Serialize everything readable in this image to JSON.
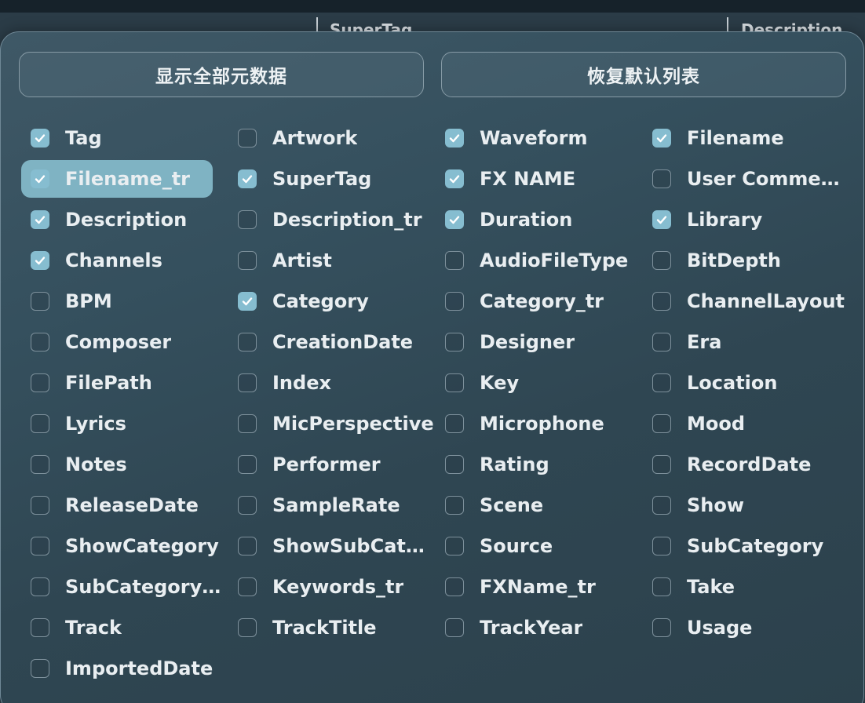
{
  "background": {
    "columns": [
      "SuperTag",
      "Description"
    ]
  },
  "buttons": {
    "show_all": "显示全部元数据",
    "restore_default": "恢复默认列表"
  },
  "items": [
    {
      "label": "Tag",
      "checked": true
    },
    {
      "label": "Artwork",
      "checked": false
    },
    {
      "label": "Waveform",
      "checked": true
    },
    {
      "label": "Filename",
      "checked": true
    },
    {
      "label": "Filename_tr",
      "checked": true,
      "highlighted": true
    },
    {
      "label": "SuperTag",
      "checked": true
    },
    {
      "label": "FX NAME",
      "checked": true
    },
    {
      "label": "User Comments",
      "checked": false
    },
    {
      "label": "Description",
      "checked": true
    },
    {
      "label": "Description_tr",
      "checked": false
    },
    {
      "label": "Duration",
      "checked": true
    },
    {
      "label": "Library",
      "checked": true
    },
    {
      "label": "Channels",
      "checked": true
    },
    {
      "label": "Artist",
      "checked": false
    },
    {
      "label": "AudioFileType",
      "checked": false
    },
    {
      "label": "BitDepth",
      "checked": false
    },
    {
      "label": "BPM",
      "checked": false
    },
    {
      "label": "Category",
      "checked": true
    },
    {
      "label": "Category_tr",
      "checked": false
    },
    {
      "label": "ChannelLayout",
      "checked": false
    },
    {
      "label": "Composer",
      "checked": false
    },
    {
      "label": "CreationDate",
      "checked": false
    },
    {
      "label": "Designer",
      "checked": false
    },
    {
      "label": "Era",
      "checked": false
    },
    {
      "label": "FilePath",
      "checked": false
    },
    {
      "label": "Index",
      "checked": false
    },
    {
      "label": "Key",
      "checked": false
    },
    {
      "label": "Location",
      "checked": false
    },
    {
      "label": "Lyrics",
      "checked": false
    },
    {
      "label": "MicPerspective",
      "checked": false
    },
    {
      "label": "Microphone",
      "checked": false
    },
    {
      "label": "Mood",
      "checked": false
    },
    {
      "label": "Notes",
      "checked": false
    },
    {
      "label": "Performer",
      "checked": false
    },
    {
      "label": "Rating",
      "checked": false
    },
    {
      "label": "RecordDate",
      "checked": false
    },
    {
      "label": "ReleaseDate",
      "checked": false
    },
    {
      "label": "SampleRate",
      "checked": false
    },
    {
      "label": "Scene",
      "checked": false
    },
    {
      "label": "Show",
      "checked": false
    },
    {
      "label": "ShowCategory",
      "checked": false
    },
    {
      "label": "ShowSubCate...",
      "checked": false
    },
    {
      "label": "Source",
      "checked": false
    },
    {
      "label": "SubCategory",
      "checked": false
    },
    {
      "label": "SubCategory_tr",
      "checked": false
    },
    {
      "label": "Keywords_tr",
      "checked": false
    },
    {
      "label": "FXName_tr",
      "checked": false
    },
    {
      "label": "Take",
      "checked": false
    },
    {
      "label": "Track",
      "checked": false
    },
    {
      "label": "TrackTitle",
      "checked": false
    },
    {
      "label": "TrackYear",
      "checked": false
    },
    {
      "label": "Usage",
      "checked": false
    },
    {
      "label": "ImportedDate",
      "checked": false
    }
  ]
}
